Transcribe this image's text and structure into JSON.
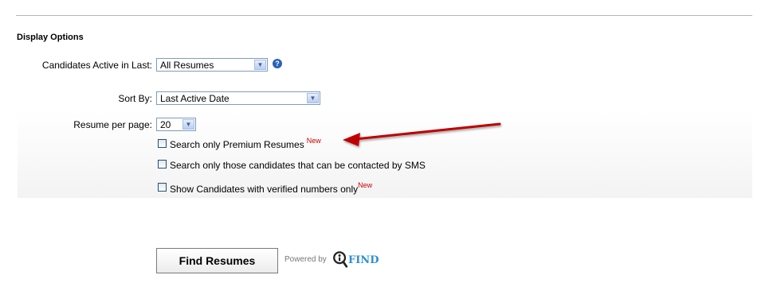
{
  "section": {
    "title": "Display Options"
  },
  "fields": {
    "active": {
      "label": "Candidates Active in Last:",
      "value": "All Resumes"
    },
    "sort": {
      "label": "Sort By:",
      "value": "Last Active Date"
    },
    "perpage": {
      "label": "Resume per page:",
      "value": "20"
    }
  },
  "help_icon": {
    "glyph": "?"
  },
  "checkboxes": [
    {
      "label": "Search only Premium Resumes",
      "badge": "New",
      "checked": false
    },
    {
      "label": "Search only those candidates that can be contacted by SMS",
      "badge": "",
      "checked": false
    },
    {
      "label": "Show Candidates with verified numbers only",
      "badge": "New",
      "checked": false
    }
  ],
  "button": {
    "label": "Find Resumes"
  },
  "powered": {
    "text": "Powered by",
    "brand": "FIND"
  },
  "arrow": {
    "color": "#c00000"
  }
}
